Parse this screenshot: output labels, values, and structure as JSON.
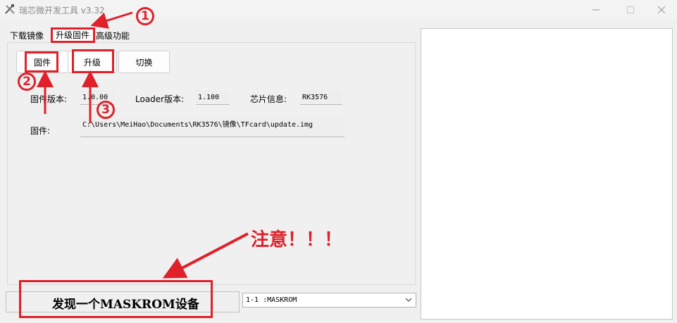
{
  "window": {
    "title": "瑞芯微开发工具 v3.32",
    "min_icon": "minimize-icon",
    "max_icon": "maximize-icon",
    "close_icon": "close-icon"
  },
  "tabs": [
    {
      "label": "下载镜像",
      "active": false
    },
    {
      "label": "升级固件",
      "active": true
    },
    {
      "label": "高级功能",
      "active": false
    }
  ],
  "buttons": {
    "firmware": "固件",
    "upgrade": "升级",
    "switch": "切换"
  },
  "info": {
    "firmware_version_label": "固件版本:",
    "firmware_version": "1.0.00",
    "loader_version_label": "Loader版本:",
    "loader_version": "1.100",
    "chip_info_label": "芯片信息:",
    "chip_info": "RK3576",
    "firmware_path_label": "固件:",
    "firmware_path": "C:\\Users\\MeiHao\\Documents\\RK3576\\镜像\\TFcard\\update.img"
  },
  "status": {
    "text": "发现一个MASKROM设备"
  },
  "device_select": {
    "value": "1-1 :MASKROM"
  },
  "annotations": {
    "step1": "1",
    "step2": "2",
    "step3": "3",
    "warning": "注意！！！",
    "color": "#e0202a"
  }
}
